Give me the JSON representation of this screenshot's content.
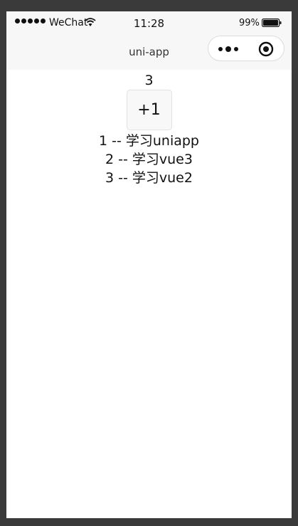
{
  "status_bar": {
    "carrier": "WeChat",
    "time": "11:28",
    "battery": "99%",
    "battery_level": 0.99
  },
  "nav": {
    "title": "uni-app",
    "more_icon": "more-dots-icon",
    "close_icon": "target-close-icon"
  },
  "main": {
    "count": "3",
    "increment_label": "+1",
    "items": [
      "1 -- 学习uniapp",
      "2 -- 学习vue3",
      "3 -- 学习vue2"
    ]
  },
  "colors": {
    "page_bg": "#3a3a3a",
    "screen_bg": "#ffffff",
    "bar_bg": "#f7f7f7",
    "text": "#111111"
  }
}
